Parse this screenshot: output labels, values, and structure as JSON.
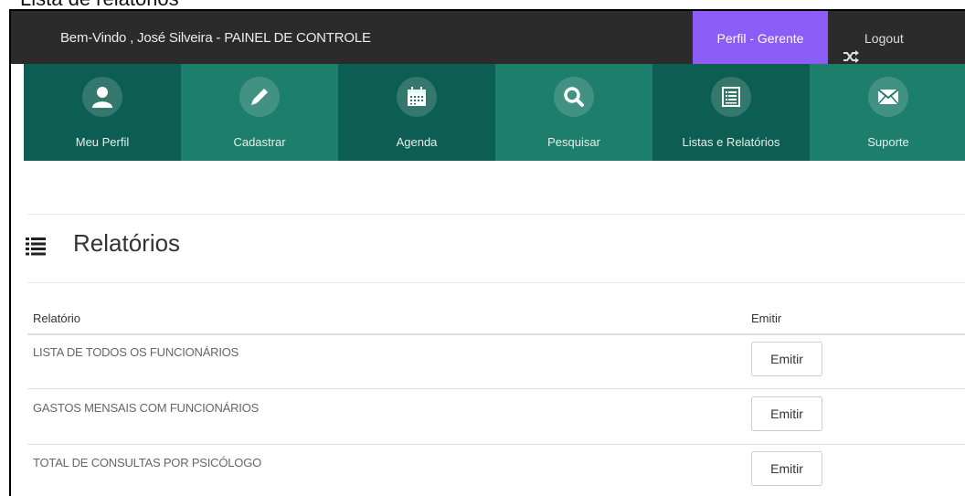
{
  "caption": "Lista de relatórios",
  "topbar": {
    "welcome": "Bem-Vindo , José  Silveira - PAINEL DE CONTROLE",
    "profile": "Perfil - Gerente",
    "logout": "Logout"
  },
  "nav": [
    {
      "label": "Meu Perfil",
      "icon": "user-icon"
    },
    {
      "label": "Cadastrar",
      "icon": "pencil-icon"
    },
    {
      "label": "Agenda",
      "icon": "calendar-icon"
    },
    {
      "label": "Pesquisar",
      "icon": "search-icon"
    },
    {
      "label": "Listas e Relatórios",
      "icon": "list-icon"
    },
    {
      "label": "Suporte",
      "icon": "envelope-icon"
    }
  ],
  "page": {
    "title": "Relatórios"
  },
  "table": {
    "headers": [
      "Relatório",
      "Emitir"
    ],
    "rows": [
      {
        "name": "LISTA DE TODOS OS FUNCIONÁRIOS",
        "action": "Emitir"
      },
      {
        "name": "GASTOS MENSAIS COM FUNCIONÁRIOS",
        "action": "Emitir"
      },
      {
        "name": "TOTAL DE CONSULTAS POR PSICÓLOGO",
        "action": "Emitir"
      }
    ]
  },
  "colors": {
    "topbar": "#2b2b2b",
    "profile": "#8b5cf6",
    "tile_dark": "#0d5e52",
    "tile_light": "#1e7e6c"
  }
}
